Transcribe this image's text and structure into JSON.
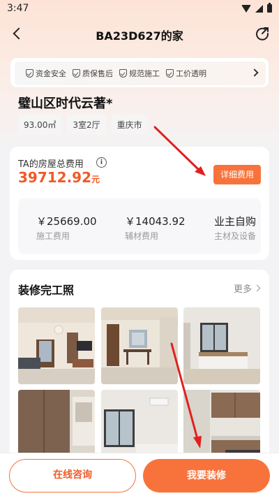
{
  "status_bar": {
    "time": "3:47"
  },
  "nav": {
    "title": "BA23D627的家"
  },
  "guarantees": [
    {
      "label": "资金安全"
    },
    {
      "label": "质保售后"
    },
    {
      "label": "规范施工"
    },
    {
      "label": "工价透明"
    }
  ],
  "project": {
    "name": "璧山区时代云著*",
    "tags": [
      "93.00㎡",
      "3室2厅",
      "重庆市"
    ]
  },
  "cost": {
    "label": "TA的房屋总费用",
    "total": "39712.92",
    "unit": "元",
    "detail_button": "详细费用",
    "breakdown": [
      {
        "value": "￥25669.00",
        "label": "施工费用"
      },
      {
        "value": "￥14043.92",
        "label": "辅材费用"
      },
      {
        "value": "业主自购",
        "label": "主材及设备"
      }
    ]
  },
  "photos": {
    "title": "装修完工照",
    "more_label": "更多",
    "items": [
      {
        "alt": "客厅"
      },
      {
        "alt": "餐厅"
      },
      {
        "alt": "卧室"
      },
      {
        "alt": "衣柜"
      },
      {
        "alt": "卧室窗户"
      },
      {
        "alt": "厨房"
      }
    ]
  },
  "bottom": {
    "consult_label": "在线咨询",
    "renovate_label": "我要装修"
  },
  "colors": {
    "accent": "#f8733c",
    "price": "#f05a28",
    "annotation_arrow": "#e02020"
  }
}
